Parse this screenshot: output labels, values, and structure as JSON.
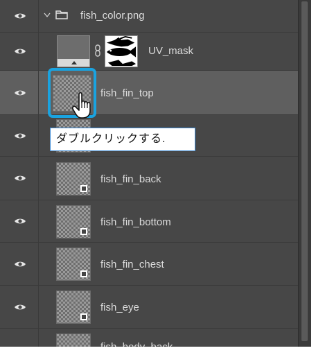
{
  "group": {
    "name": "fish_color.png"
  },
  "layers": [
    {
      "name": "UV_mask"
    },
    {
      "name": "fish_fin_top"
    },
    {
      "name": ""
    },
    {
      "name": "fish_fin_back"
    },
    {
      "name": "fish_fin_bottom"
    },
    {
      "name": "fish_fin_chest"
    },
    {
      "name": "fish_eye"
    },
    {
      "name": "fish_body_back"
    }
  ],
  "tooltip": {
    "text": "ダブルクリックする."
  },
  "colors": {
    "panel": "#474747",
    "selected": "#5f5f5f",
    "highlight": "#1aa3e0"
  },
  "icons": [
    "eye-icon",
    "folder-icon",
    "chevron-down-icon",
    "link-icon",
    "smart-object-icon",
    "hand-cursor-icon"
  ]
}
